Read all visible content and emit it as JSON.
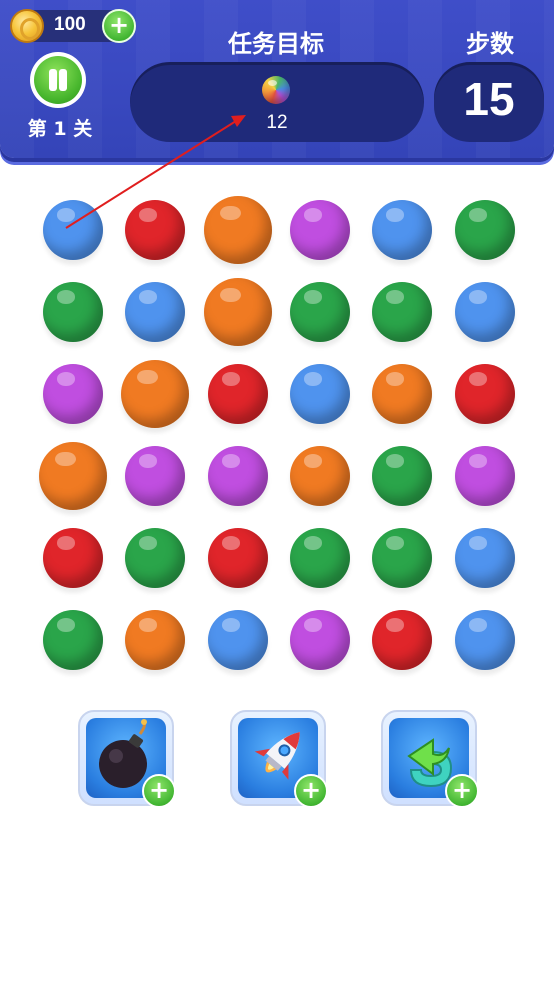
{
  "header": {
    "coins": "100",
    "coin_add_icon": "plus-icon",
    "level_label": "第 1 关",
    "goal_title": "任务目标",
    "goal_item_icon": "rainbow-ball-icon",
    "goal_count": "12",
    "steps_title": "步数",
    "steps_value": "15"
  },
  "board": {
    "rows": 6,
    "cols": 6,
    "colors": {
      "blue": "#4f93ee",
      "red": "#e0252a",
      "orange": "#f07a22",
      "purple": "#c04ee0",
      "green": "#2aa54a"
    },
    "grid": [
      [
        "blue",
        "red",
        "orange",
        "purple",
        "blue",
        "green"
      ],
      [
        "green",
        "blue",
        "orange",
        "green",
        "green",
        "blue"
      ],
      [
        "purple",
        "orange",
        "red",
        "blue",
        "orange",
        "red"
      ],
      [
        "orange",
        "purple",
        "purple",
        "orange",
        "green",
        "purple"
      ],
      [
        "red",
        "green",
        "red",
        "green",
        "green",
        "blue"
      ],
      [
        "green",
        "orange",
        "blue",
        "purple",
        "red",
        "blue"
      ]
    ],
    "large_cells": [
      [
        0,
        2
      ],
      [
        1,
        2
      ],
      [
        2,
        1
      ],
      [
        3,
        0
      ]
    ]
  },
  "tools": [
    {
      "icon": "bomb-icon",
      "add_icon": "plus-icon"
    },
    {
      "icon": "rocket-icon",
      "add_icon": "plus-icon"
    },
    {
      "icon": "undo-arrow-icon",
      "add_icon": "plus-icon"
    }
  ],
  "annotation": {
    "color": "#e01e1e"
  }
}
